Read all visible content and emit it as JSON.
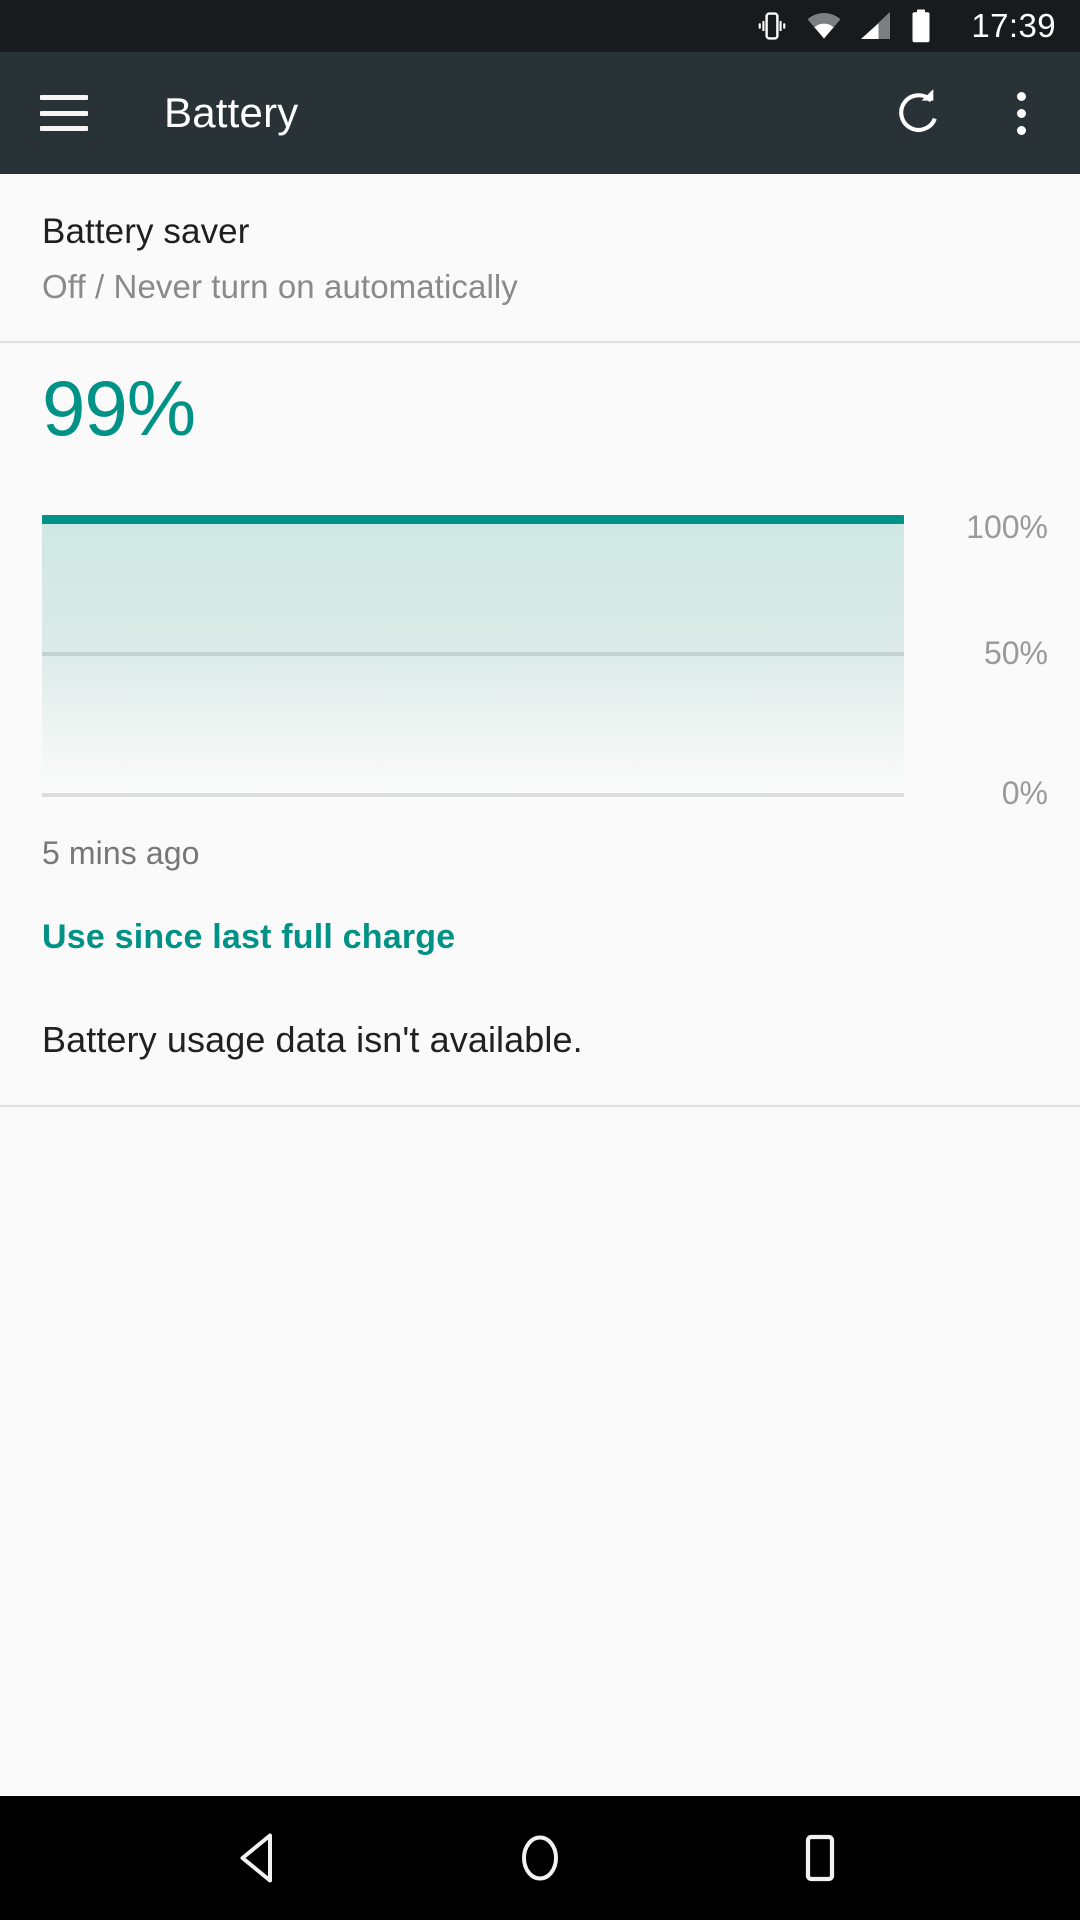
{
  "status_bar": {
    "time": "17:39",
    "icons": [
      "vibrate-icon",
      "wifi-icon",
      "cellular-signal-icon",
      "battery-icon"
    ]
  },
  "app_bar": {
    "title": "Battery",
    "menu_icon": "hamburger-menu-icon",
    "refresh_icon": "refresh-icon",
    "overflow_icon": "overflow-menu-icon"
  },
  "battery_saver": {
    "title": "Battery saver",
    "subtitle": "Off / Never turn on automatically"
  },
  "battery_level": {
    "percent_label": "99%",
    "last_updated": "5 mins ago"
  },
  "links": {
    "use_since_last_full_charge": "Use since last full charge"
  },
  "usage": {
    "empty_message": "Battery usage data isn't available."
  },
  "nav_bar": {
    "back": "back-button",
    "home": "home-button",
    "recents": "recents-button"
  },
  "colors": {
    "accent_teal": "#009286",
    "status_bar_bg": "#171b1d",
    "app_bar_bg": "#283237",
    "page_bg": "#fafafa",
    "secondary_text": "#8a8a8a",
    "primary_text": "#212121",
    "nav_bar_bg": "#000000"
  },
  "chart_data": {
    "type": "area",
    "title": "",
    "xlabel": "",
    "ylabel": "",
    "ylim": [
      0,
      100
    ],
    "ytick_labels": [
      "100%",
      "50%",
      "0%"
    ],
    "ytick_values": [
      100,
      50,
      0
    ],
    "grid": true,
    "legend": "none",
    "series": [
      {
        "name": "Battery level",
        "values": [
          99,
          99,
          99,
          99,
          99,
          99,
          99,
          99,
          99,
          99,
          99,
          99
        ],
        "line_color": "#009286",
        "fill": "teal-gradient"
      }
    ],
    "x": [
      0,
      1,
      2,
      3,
      4,
      5,
      6,
      7,
      8,
      9,
      10,
      11
    ],
    "annotations": [
      "5 mins ago"
    ]
  }
}
